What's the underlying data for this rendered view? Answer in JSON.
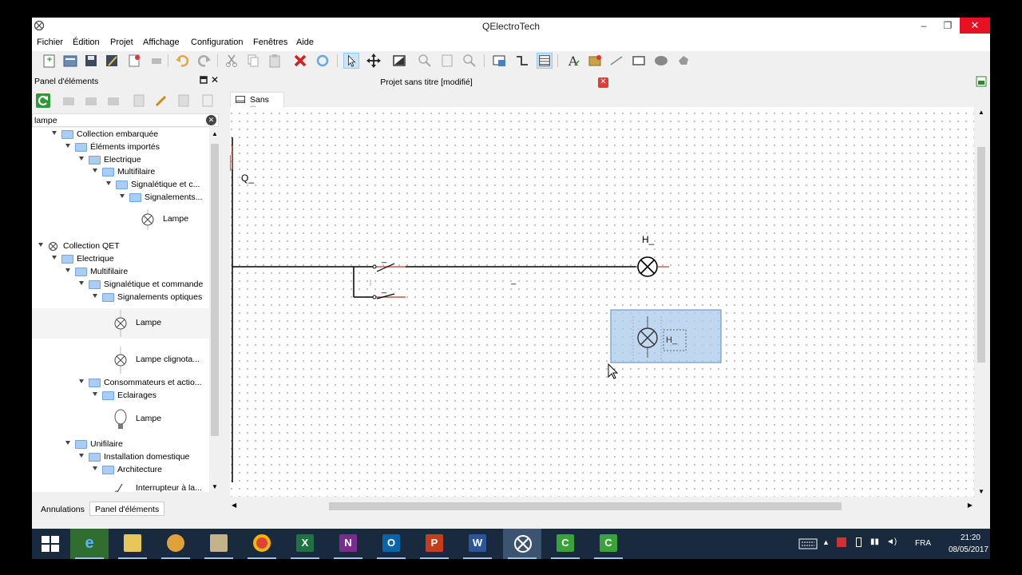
{
  "window": {
    "title": "QElectroTech",
    "controls": {
      "minimize": "–",
      "restore": "❐",
      "close": "✕"
    }
  },
  "menu": [
    "Fichier",
    "Édition",
    "Projet",
    "Affichage",
    "Configuration",
    "Fenêtres",
    "Aide"
  ],
  "panel": {
    "title": "Panel d'éléments",
    "search_value": "lampe",
    "tree": [
      {
        "label": "Collection embarquée",
        "level": 1,
        "type": "folder"
      },
      {
        "label": "Éléments importés",
        "level": 2,
        "type": "folder"
      },
      {
        "label": "Electrique",
        "level": 3,
        "type": "folder"
      },
      {
        "label": "Multifilaire",
        "level": 4,
        "type": "folder"
      },
      {
        "label": "Signalétique et c...",
        "level": 5,
        "type": "folder"
      },
      {
        "label": "Signalements...",
        "level": 6,
        "type": "folder"
      },
      {
        "label": "Lampe",
        "level": 7,
        "type": "element"
      },
      {
        "label": "Collection QET",
        "level": 0,
        "type": "collection"
      },
      {
        "label": "Electrique",
        "level": 1,
        "type": "folder"
      },
      {
        "label": "Multifilaire",
        "level": 2,
        "type": "folder"
      },
      {
        "label": "Signalétique et commande",
        "level": 3,
        "type": "folder"
      },
      {
        "label": "Signalements optiques",
        "level": 4,
        "type": "folder"
      },
      {
        "label": "Lampe",
        "level": 5,
        "type": "element"
      },
      {
        "label": "Lampe clignota...",
        "level": 5,
        "type": "element"
      },
      {
        "label": "Consommateurs et actio...",
        "level": 3,
        "type": "folder"
      },
      {
        "label": "Eclairages",
        "level": 4,
        "type": "folder"
      },
      {
        "label": "Lampe",
        "level": 5,
        "type": "element"
      },
      {
        "label": "Unifilaire",
        "level": 2,
        "type": "folder"
      },
      {
        "label": "Installation domestique",
        "level": 3,
        "type": "folder"
      },
      {
        "label": "Architecture",
        "level": 4,
        "type": "folder"
      },
      {
        "label": "Interrupteur à la...",
        "level": 5,
        "type": "element"
      }
    ]
  },
  "bottom_tabs": [
    "Annulations",
    "Panel d'éléments"
  ],
  "document": {
    "tab_title": "Projet sans titre [modifié]",
    "sheet_tab": "Sans titre"
  },
  "diagram": {
    "breaker_label": "Q_",
    "lamp_label": "H_",
    "switch_label_1": "_",
    "switch_label_2": "_",
    "wire_label": "_",
    "dragged_lamp_label": "H_"
  },
  "taskbar": {
    "apps": [
      "windows-start",
      "internet-explorer",
      "file-explorer",
      "chrome-like",
      "archive",
      "chrome",
      "excel",
      "onenote",
      "outlook",
      "powerpoint",
      "word",
      "qelectrotech",
      "camtasia-1",
      "camtasia-2"
    ],
    "language": "FRA",
    "time": "21:20",
    "date": "08/05/2017"
  }
}
